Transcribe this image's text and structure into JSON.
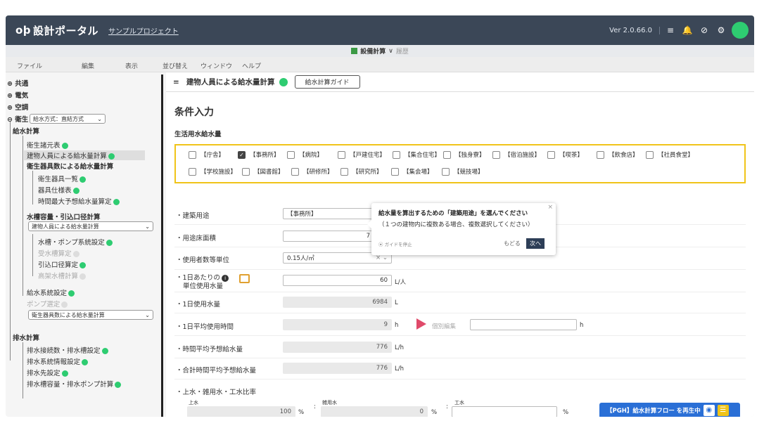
{
  "header": {
    "logo_mark": "oþ",
    "app_title": "設計ポータル",
    "project_link": "サンプルプロジェクト",
    "version": "Ver 2.0.66.0",
    "avatar_color": "#2ecc71"
  },
  "subbar": {
    "title": "設備計算",
    "chevron": "∨",
    "history": "履歴"
  },
  "menu": {
    "file": "ファイル",
    "edit": "編集",
    "view": "表示",
    "sort": "並び替え",
    "window": "ウィンドウ",
    "help": "ヘルプ"
  },
  "sidebar": {
    "common": "共通",
    "electric": "電気",
    "aircon": "空調",
    "sanitary": "衛生",
    "supply_method": "給水方式：直結方式",
    "water_calc": "給水計算",
    "fixture_elements": "衛生諸元表",
    "by_people": "建物人員による給水量計算",
    "by_fixtures": "衛生器具数による給水量計算",
    "fixture_list": "衛生器具一覧",
    "fixture_spec": "器具仕様表",
    "peak_time": "時間最大予想給水量算定",
    "tank_calc": "水槽容量・引込口径計算",
    "tank_source": "建物人員による給水量計算",
    "tank_pump": "水槽・ポンプ系統設定",
    "tank_required": "受水槽算定",
    "inlet_diameter": "引込口径算定",
    "elevated_tank": "高架水槽計算",
    "supply_system": "給水系統設定",
    "pump_select": "ポンプ選定",
    "pump_source": "衛生器具数による給水量計算",
    "drain_calc": "排水計算",
    "drain_connect": "排水接続数・排水槽設定",
    "drain_system": "排水系統情報設定",
    "drain_destination": "排水先設定",
    "drain_tank": "排水槽容量・排水ポンプ計算"
  },
  "main": {
    "menu_icon": "≡",
    "page_title": "建物人員による給水量計算",
    "guide_button": "給水計算ガイド",
    "section_title": "条件入力",
    "subsection": "生活用水給水量",
    "uses_row1": [
      {
        "label": "【庁舎】",
        "checked": false
      },
      {
        "label": "【事務所】",
        "checked": true
      },
      {
        "label": "【病院】",
        "checked": false
      },
      {
        "label": "【戸建住宅】",
        "checked": false
      },
      {
        "label": "【集合住宅】",
        "checked": false
      },
      {
        "label": "【独身寮】",
        "checked": false
      },
      {
        "label": "【宿泊施設】",
        "checked": false
      },
      {
        "label": "【喫茶】",
        "checked": false
      },
      {
        "label": "【飲食店】",
        "checked": false
      },
      {
        "label": "【社員食堂】",
        "checked": false
      }
    ],
    "uses_row2": [
      {
        "label": "【学校施設】",
        "checked": false
      },
      {
        "label": "【図書館】",
        "checked": false
      },
      {
        "label": "【研修所】",
        "checked": false
      },
      {
        "label": "【研究所】",
        "checked": false
      },
      {
        "label": "【集会場】",
        "checked": false
      },
      {
        "label": "【競技場】",
        "checked": false
      }
    ],
    "building_use_label": "・建築用途",
    "building_use_value": "【事務所】",
    "floor_area_label": "・用途床面積",
    "floor_area_value": "7",
    "occupant_unit_label": "・使用者数等単位",
    "occupant_unit_value": "0.15人/㎡",
    "daily_unit_label1": "・1日あたりの",
    "daily_unit_label2": "単位使用水量",
    "daily_unit_value": "60",
    "daily_unit_unit": "L/人",
    "daily_use_label": "・1日使用水量",
    "daily_use_value": "6984",
    "daily_use_unit": "L",
    "avg_hours_label": "・1日平均使用時間",
    "avg_hours_value": "9",
    "avg_hours_unit": "h",
    "individual_edit": "個別編集",
    "individual_unit": "h",
    "hourly_peak_label": "・時間平均予想給水量",
    "hourly_peak_value": "776",
    "hourly_peak_unit": "L/h",
    "total_peak_label": "・合計時間平均予想給水量",
    "total_peak_value": "776",
    "total_peak_unit": "L/h",
    "ratio_label": "・上水・雑用水・工水比率",
    "ratio_upper_label": "上水",
    "ratio_upper_value": "100",
    "ratio_misc_label": "雑用水",
    "ratio_misc_value": "0",
    "ratio_ind_label": "工水",
    "ratio_unit": "%",
    "ratio_sep": ":"
  },
  "tooltip": {
    "line1": "給水量を算出するための「建築用途」を選んでください",
    "line2": "（１つの建物内に複数ある場合、複数選択してください）",
    "stop": "ガイドを停止",
    "back": "もどる",
    "next": "次へ",
    "close": "×"
  },
  "flow": {
    "text": "【PGH】給水計算フロー を再生中"
  }
}
